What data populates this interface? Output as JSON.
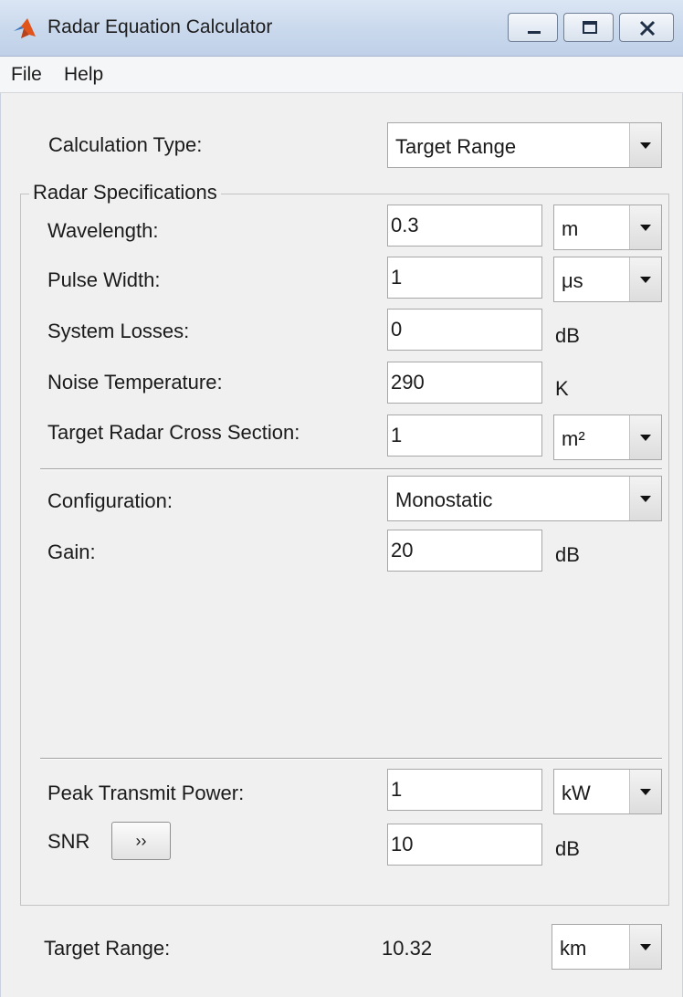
{
  "window": {
    "title": "Radar Equation Calculator"
  },
  "menu": {
    "items": [
      "File",
      "Help"
    ]
  },
  "calculation": {
    "label": "Calculation Type:",
    "value": "Target Range"
  },
  "radar_specs": {
    "title": "Radar Specifications",
    "wavelength": {
      "label": "Wavelength:",
      "value": "0.3",
      "unit": "m"
    },
    "pulse_width": {
      "label": "Pulse Width:",
      "value": "1",
      "unit": "μs"
    },
    "system_losses": {
      "label": "System Losses:",
      "value": "0",
      "unit": "dB"
    },
    "noise_temperature": {
      "label": "Noise Temperature:",
      "value": "290",
      "unit": "K"
    },
    "rcs": {
      "label": "Target Radar Cross Section:",
      "value": "1",
      "unit": "m²"
    },
    "configuration": {
      "label": "Configuration:",
      "value": "Monostatic"
    },
    "gain": {
      "label": "Gain:",
      "value": "20",
      "unit": "dB"
    },
    "peak_power": {
      "label": "Peak Transmit Power:",
      "value": "1",
      "unit": "kW"
    },
    "snr": {
      "label": "SNR",
      "button": "››",
      "value": "10",
      "unit": "dB"
    }
  },
  "result": {
    "label": "Target Range:",
    "value": "10.32",
    "unit": "km"
  },
  "colors": {
    "titlebar": "#c9d8ec",
    "background": "#f0f0f0",
    "icon_accent": "#e0531a"
  }
}
